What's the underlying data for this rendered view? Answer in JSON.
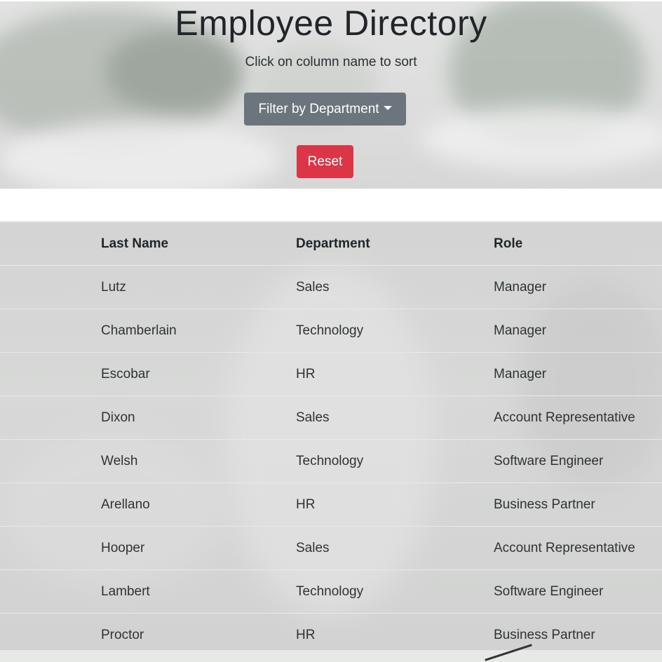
{
  "header": {
    "title": "Employee Directory",
    "subtitle": "Click on column name to sort",
    "filter_label": "Filter by Department",
    "reset_label": "Reset"
  },
  "colors": {
    "filter_button": "#6c757d",
    "reset_button": "#dc3545"
  },
  "table": {
    "columns": [
      "Last Name",
      "Department",
      "Role"
    ],
    "rows": [
      [
        "Lutz",
        "Sales",
        "Manager"
      ],
      [
        "Chamberlain",
        "Technology",
        "Manager"
      ],
      [
        "Escobar",
        "HR",
        "Manager"
      ],
      [
        "Dixon",
        "Sales",
        "Account Representative"
      ],
      [
        "Welsh",
        "Technology",
        "Software Engineer"
      ],
      [
        "Arellano",
        "HR",
        "Business Partner"
      ],
      [
        "Hooper",
        "Sales",
        "Account Representative"
      ],
      [
        "Lambert",
        "Technology",
        "Software Engineer"
      ],
      [
        "Proctor",
        "HR",
        "Business Partner"
      ]
    ]
  }
}
